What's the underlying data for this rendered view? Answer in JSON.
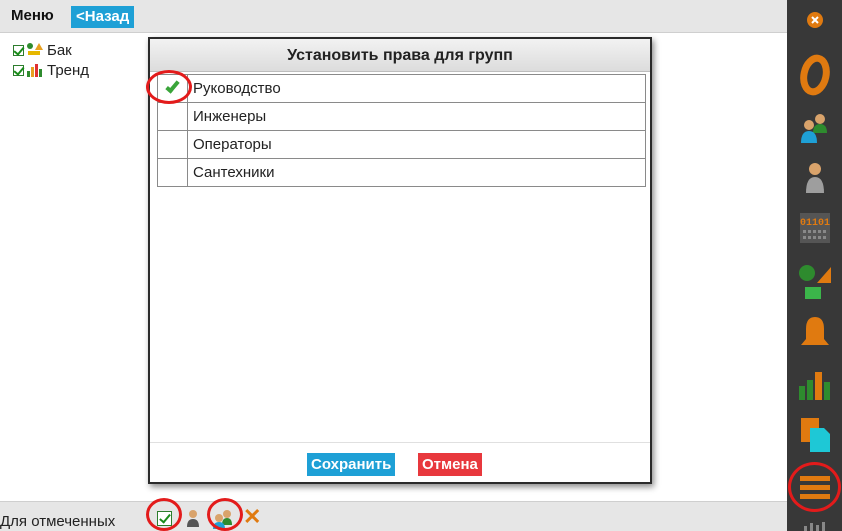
{
  "header": {
    "menu_title": "Меню",
    "back_label": "<Назад"
  },
  "tree": {
    "items": [
      {
        "label": "Бак",
        "checked": true,
        "icon": "tank-icon"
      },
      {
        "label": "Тренд",
        "checked": true,
        "icon": "trend-chart-icon"
      }
    ]
  },
  "dialog": {
    "title": "Установить права для групп",
    "groups": [
      {
        "name": "Руководство",
        "checked": true
      },
      {
        "name": "Инженеры",
        "checked": false
      },
      {
        "name": "Операторы",
        "checked": false
      },
      {
        "name": "Сантехники",
        "checked": false
      }
    ],
    "save_label": "Сохранить",
    "cancel_label": "Отмена"
  },
  "footer": {
    "label": "Для отмеченных"
  },
  "toolbar": {
    "items": [
      "close-icon",
      "o-logo-icon",
      "groups-icon",
      "user-icon",
      "binary-display-icon",
      "shapes-icon",
      "bell-icon",
      "bar-chart-icon",
      "documents-icon",
      "hamburger-menu-icon"
    ]
  },
  "colors": {
    "accent": "#1ea0d6",
    "cancel": "#e8383d",
    "toolbar_bg": "#383838",
    "highlight_ring": "#e31b1b",
    "orange": "#e07a10",
    "green": "#2e8b2e"
  }
}
